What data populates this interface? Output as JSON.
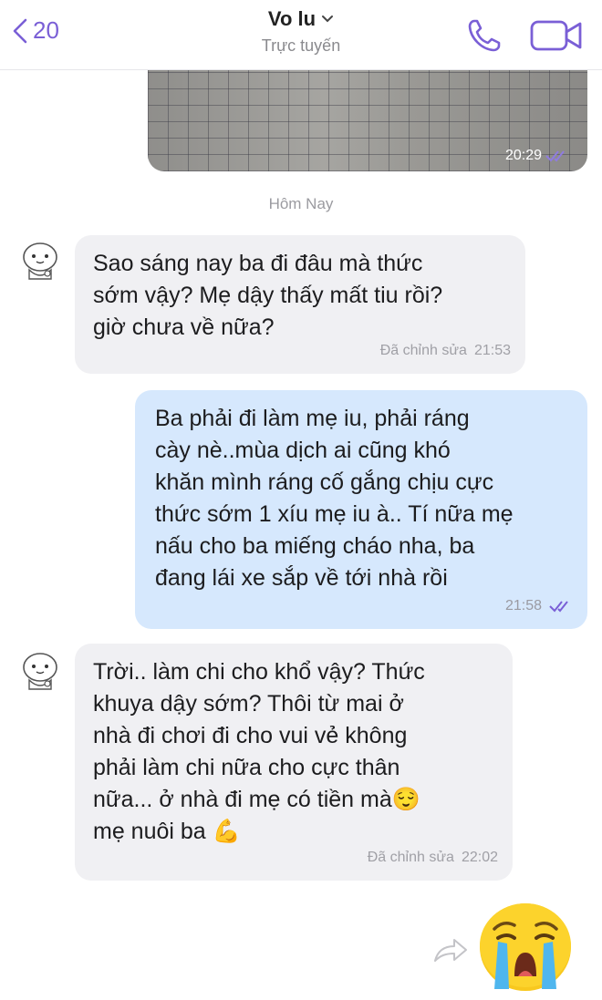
{
  "header": {
    "back_count": "20",
    "contact_name": "Vo lu",
    "status": "Trực tuyến"
  },
  "photo_message": {
    "time": "20:29"
  },
  "date_separator": "Hôm Nay",
  "messages": [
    {
      "direction": "in",
      "text": "Sao sáng nay ba đi đâu mà thức\nsớm vậy? Mẹ dậy thấy mất tiu rồi?\ngiờ chưa về nữa?",
      "edited": "Đã chỉnh sửa",
      "time": "21:53"
    },
    {
      "direction": "out",
      "text": "Ba phải đi làm mẹ iu, phải ráng\ncày nè..mùa dịch ai cũng khó\nkhăn mình ráng cố gắng chịu cực\nthức sớm 1 xíu mẹ iu à.. Tí nữa mẹ\nnấu cho ba miếng cháo nha, ba\nđang lái xe sắp về tới nhà rồi",
      "time": "21:58"
    },
    {
      "direction": "in",
      "text": "Trời.. làm chi cho khổ vậy? Thức\nkhuya dậy sớm? Thôi từ mai ở\nnhà đi chơi đi cho vui vẻ không\nphải làm chi nữa cho cực thân\nnữa... ở nhà đi mẹ có tiền mà😌\nmẹ nuôi ba 💪",
      "edited": "Đã chỉnh sửa",
      "time": "22:02"
    }
  ],
  "icons": {
    "back": "chevron-left-icon",
    "call": "phone-icon",
    "video": "video-camera-icon",
    "read": "double-check-icon",
    "forward": "forward-arrow-icon",
    "sticker": "crying-face-sticker"
  },
  "colors": {
    "accent": "#7a5fd6",
    "incoming_bubble": "#f0f0f3",
    "outgoing_bubble": "#d6e8fd",
    "meta_text": "#a0a0a6"
  }
}
